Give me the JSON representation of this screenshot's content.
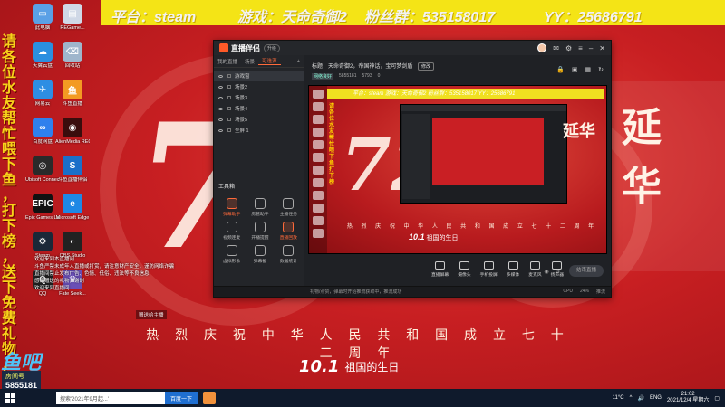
{
  "overlay": {
    "platform": "平台：steam",
    "game": "游戏：天命奇御2",
    "fans": "粉丝群：535158017",
    "yy": "YY：25686791",
    "left_vertical": "请各位水友帮忙喂下鱼，打下榜，送下免费礼物，谢谢"
  },
  "desktop": {
    "icons": [
      {
        "label": "此电脑",
        "glyph": "▭",
        "color": "#5aa0e6"
      },
      {
        "label": "REGame...",
        "glyph": "▤",
        "color": "#cfd8e6"
      },
      {
        "label": "天翼云盘",
        "glyph": "☁",
        "color": "#2b8fe0"
      },
      {
        "label": "回收站",
        "glyph": "⌫",
        "color": "#9fb6cc"
      },
      {
        "label": "网易云",
        "glyph": "✈",
        "color": "#2d8ee3"
      },
      {
        "label": "斗鱼直播",
        "glyph": "鱼",
        "color": "#f39a23"
      },
      {
        "label": "百度网盘",
        "glyph": "∞",
        "color": "#2f80ed"
      },
      {
        "label": "AlienMedia RECentral",
        "glyph": "◉",
        "color": "#3a0d0d"
      },
      {
        "label": "Ubisoft Connect",
        "glyph": "◎",
        "color": "#2a2a2a"
      },
      {
        "label": "斗鱼直播伴侣",
        "glyph": "S",
        "color": "#1b6fc9"
      },
      {
        "label": "Epic Games Launcher",
        "glyph": "EPIC",
        "color": "#111"
      },
      {
        "label": "Microsoft Edge",
        "glyph": "e",
        "color": "#1e88e5"
      },
      {
        "label": "Steam",
        "glyph": "⚙",
        "color": "#1b2838"
      },
      {
        "label": "OBS Studio",
        "glyph": "◐",
        "color": "#222"
      },
      {
        "label": "QQ",
        "glyph": "Q",
        "color": "#222"
      },
      {
        "label": "Fate Seek...",
        "glyph": "♛",
        "color": "#6a4fb6"
      }
    ],
    "chat_lines": [
      "欢迎来到本直播间",
      "斗鱼严禁未成年人直播或打赏，请注意财产安全，谨防网络诈骗",
      "直播间禁止发布广告、色情、低俗、违法等不良信息",
      "感谢赠送的礼物，谢谢",
      "欢迎来到直播间"
    ],
    "gift_tag": "赠送给主播",
    "pane_label": "鱼吧",
    "uid_key": "房间号",
    "uid_value": "5855181",
    "wallpaper_slogan": "热 烈 庆 祝 中 华 人 民 共 和 国 成 立 七 十 二 周 年",
    "wallpaper_date_num": "10.1",
    "wallpaper_date_txt": "祖国的生日",
    "wallpaper_cjk1": "延",
    "wallpaper_cjk2": "华",
    "wallpaper_72": "72"
  },
  "app": {
    "title": "直播伴侣",
    "badge": "升级",
    "side_tabs": [
      "我的直播",
      "场景",
      "可选源"
    ],
    "scenes": [
      "游戏窗",
      "场景2",
      "场景3",
      "场景4",
      "场景5",
      "全屏 1"
    ],
    "tools_head": "工具箱",
    "tools": [
      {
        "label": "弹幕助手",
        "active": true
      },
      {
        "label": "房管助手",
        "active": false
      },
      {
        "label": "主播任务",
        "active": false
      },
      {
        "label": "视频连麦",
        "active": false
      },
      {
        "label": "开播提醒",
        "active": false
      },
      {
        "label": "直播回放",
        "active": true
      },
      {
        "label": "虚拟形象",
        "active": false
      },
      {
        "label": "弹幕截",
        "active": false
      },
      {
        "label": "数据统计",
        "active": false
      }
    ],
    "stream_title": "标题：天命奇御2，帝国神话，宝可梦剑盾",
    "edit_btn": "修改",
    "stats": [
      "5855181",
      "5793",
      "0"
    ],
    "net": "网络良好",
    "controls": [
      "直播屏幕",
      "摄像头",
      "手机投屏",
      "多媒体",
      "麦克风",
      "扬声器"
    ],
    "go_live": "结束直播",
    "status_left": "礼物/点赞，弹幕时开始推流获取中，推流成功",
    "status_right": [
      "CPU",
      "24%",
      "推流"
    ],
    "preview_yellow": "平台：steam  游戏：天命奇御2  粉丝群：535158017      YY：25686791",
    "preview_vertical": "请各位水友帮忙喂下鱼打下榜",
    "preview_slogan": "热 烈 庆 祝 中 华 人 民 共 和 国 成 立 七 十 二 周 年",
    "preview_date_num": "10.1",
    "preview_date_txt": "祖国的生日",
    "preview_cjk": "延华",
    "preview_72": "72"
  },
  "taskbar": {
    "search_placeholder": "搜索'2021年9月起...'",
    "search_btn": "百度一下",
    "temp": "11°C",
    "lang": "ENG",
    "time": "21:02",
    "date": "2021/12/4 星期六"
  }
}
